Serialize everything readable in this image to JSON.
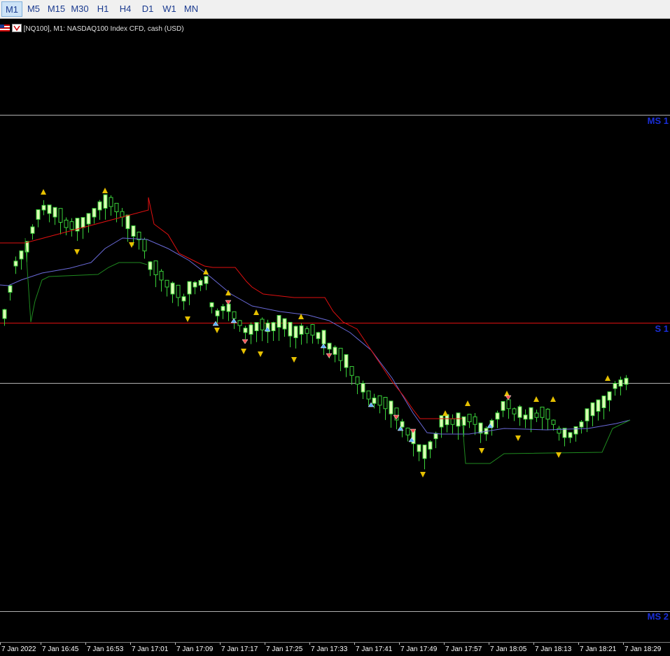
{
  "toolbar": {
    "timeframes": [
      {
        "label": "M1",
        "active": true
      },
      {
        "label": "M5",
        "active": false
      },
      {
        "label": "M15",
        "active": false
      },
      {
        "label": "M30",
        "active": false
      },
      {
        "label": "H1",
        "active": false
      },
      {
        "label": "H4",
        "active": false
      },
      {
        "label": "D1",
        "active": false
      },
      {
        "label": "W1",
        "active": false
      },
      {
        "label": "MN",
        "active": false
      }
    ]
  },
  "chart": {
    "info_text": "[NQ100], M1:  NASDAQ100 Index CFD, cash (USD)",
    "icons": [
      "flag-icon",
      "trend-arrow-icon"
    ],
    "colors": {
      "background": "#000000",
      "bull_candle": "#dcffb4",
      "bear_candle": "#000000",
      "wick": "#3ad23a",
      "ma_line": "#6a6ad8",
      "upper_stop": "#e01010",
      "lower_stop": "#1f8a1f",
      "level_line": "#b0b0b0",
      "s1_line": "#e01010",
      "level_label": "#1a2ed8",
      "fractal_marker": "#e6c000"
    },
    "levels": [
      {
        "label": "MS 1",
        "line": "gray"
      },
      {
        "label": "S 1",
        "line": "red"
      },
      {
        "label": "",
        "line": "gray"
      },
      {
        "label": "MS 2",
        "line": "gray"
      }
    ],
    "time_labels": [
      "7 Jan 2022",
      "7 Jan 16:45",
      "7 Jan 16:53",
      "7 Jan 17:01",
      "7 Jan 17:09",
      "7 Jan 17:17",
      "7 Jan 17:25",
      "7 Jan 17:33",
      "7 Jan 17:41",
      "7 Jan 17:49",
      "7 Jan 17:57",
      "7 Jan 18:05",
      "7 Jan 18:13",
      "7 Jan 18:21",
      "7 Jan 18:29"
    ]
  },
  "chart_data": {
    "type": "candlestick",
    "symbol": "NQ100",
    "timeframe": "M1",
    "x": [
      "7 Jan 16:37",
      "16:38",
      "16:39",
      "16:40",
      "16:41",
      "16:42",
      "16:43",
      "16:44",
      "16:45",
      "16:46",
      "16:47",
      "16:48",
      "16:49",
      "16:50",
      "16:51",
      "16:52",
      "16:53",
      "16:54",
      "16:55",
      "16:56",
      "16:57",
      "16:58",
      "16:59",
      "17:00",
      "17:01",
      "17:02",
      "17:03",
      "17:04",
      "17:05",
      "17:06",
      "17:07",
      "17:08",
      "17:09",
      "17:10",
      "17:11",
      "17:12",
      "17:13",
      "17:14",
      "17:15",
      "17:16",
      "17:17",
      "17:18",
      "17:19",
      "17:20",
      "17:21",
      "17:22",
      "17:23",
      "17:24",
      "17:25",
      "17:26",
      "17:27",
      "17:28",
      "17:29",
      "17:30",
      "17:31",
      "17:32",
      "17:33",
      "17:34",
      "17:35",
      "17:36",
      "17:37",
      "17:38",
      "17:39",
      "17:40",
      "17:41",
      "17:42",
      "17:43",
      "17:44",
      "17:45",
      "17:46",
      "17:47",
      "17:48",
      "17:49",
      "17:50",
      "17:51",
      "17:52",
      "17:53",
      "17:54",
      "17:55",
      "17:56",
      "17:57",
      "17:58",
      "17:59",
      "18:00",
      "18:01",
      "18:02",
      "18:03",
      "18:04",
      "18:05",
      "18:06",
      "18:07",
      "18:08",
      "18:09",
      "18:10",
      "18:11",
      "18:12",
      "18:13",
      "18:14",
      "18:15",
      "18:16",
      "18:17",
      "18:18",
      "18:19",
      "18:20",
      "18:21",
      "18:22",
      "18:23",
      "18:24",
      "18:25",
      "18:26",
      "18:27",
      "18:28",
      "18:29",
      "18:30",
      "18:31",
      "18:32"
    ],
    "candles_normalized_note": "y values below are relative price levels on a 0-100 scale (100 = top of visible range)",
    "open": [
      70,
      74,
      76,
      78,
      80,
      82,
      84,
      83,
      82,
      82,
      82,
      81,
      81,
      80,
      80,
      80,
      81,
      82,
      83,
      83,
      84,
      82,
      81,
      80,
      79,
      77,
      74,
      72,
      70,
      69,
      68,
      68,
      69,
      70,
      69,
      66,
      64,
      63,
      63,
      61,
      61,
      62,
      61,
      61,
      62,
      62,
      61,
      60,
      60,
      60,
      61,
      59,
      58,
      58,
      57,
      56,
      55,
      54,
      53,
      52,
      51,
      50,
      49,
      48,
      47,
      46,
      45,
      44,
      43,
      42,
      41,
      40,
      41,
      42,
      43,
      43,
      44,
      45,
      45,
      44,
      44,
      43,
      43,
      44,
      45,
      46,
      47,
      47,
      46,
      46,
      46,
      47,
      46,
      46,
      47,
      47,
      46,
      46,
      45,
      45,
      45,
      46,
      46,
      47,
      47,
      48,
      48,
      48,
      50,
      52,
      53,
      53,
      54,
      54
    ],
    "close": [
      74,
      76,
      78,
      80,
      82,
      84,
      83,
      82,
      82,
      82,
      81,
      81,
      80,
      80,
      80,
      81,
      82,
      83,
      83,
      84,
      82,
      81,
      80,
      79,
      77,
      74,
      72,
      70,
      69,
      68,
      68,
      69,
      70,
      69,
      66,
      64,
      63,
      63,
      61,
      61,
      62,
      61,
      61,
      62,
      62,
      61,
      60,
      60,
      60,
      61,
      59,
      58,
      58,
      57,
      56,
      55,
      54,
      53,
      52,
      51,
      50,
      49,
      48,
      47,
      46,
      45,
      44,
      43,
      42,
      41,
      40,
      41,
      42,
      43,
      43,
      44,
      45,
      45,
      44,
      44,
      43,
      43,
      44,
      45,
      46,
      47,
      47,
      46,
      46,
      46,
      47,
      46,
      46,
      47,
      47,
      46,
      46,
      45,
      45,
      45,
      46,
      46,
      47,
      47,
      48,
      48,
      48,
      50,
      52,
      53,
      53,
      54,
      54,
      54
    ],
    "series": [
      {
        "name": "moving-average"
      },
      {
        "name": "upper-stop"
      },
      {
        "name": "lower-stop"
      }
    ],
    "fractal_arrows": true
  }
}
